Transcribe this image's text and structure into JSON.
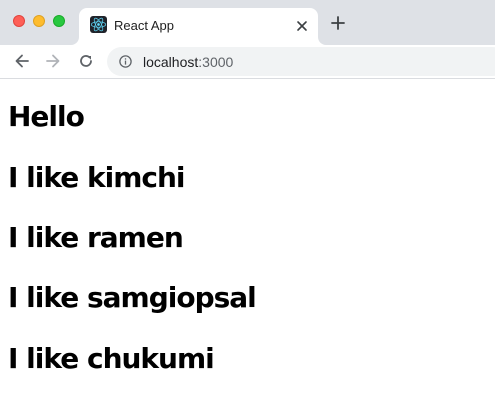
{
  "browser": {
    "tab": {
      "title": "React App",
      "favicon": "react-logo-icon"
    },
    "address_bar": {
      "host": "localhost",
      "port": ":3000",
      "security_icon": "info-icon"
    },
    "nav": {
      "back_icon": "arrow-left-icon",
      "forward_icon": "arrow-right-icon",
      "reload_icon": "reload-icon",
      "new_tab_icon": "plus-icon",
      "close_tab_icon": "close-icon"
    },
    "window_controls": {
      "close_color": "#fe5f57",
      "minimize_color": "#febc2e",
      "maximize_color": "#28c840"
    }
  },
  "page": {
    "greeting": "Hello",
    "foods": [
      {
        "text": "I like kimchi"
      },
      {
        "text": "I like ramen"
      },
      {
        "text": "I like samgiopsal"
      },
      {
        "text": "I like chukumi"
      }
    ]
  }
}
